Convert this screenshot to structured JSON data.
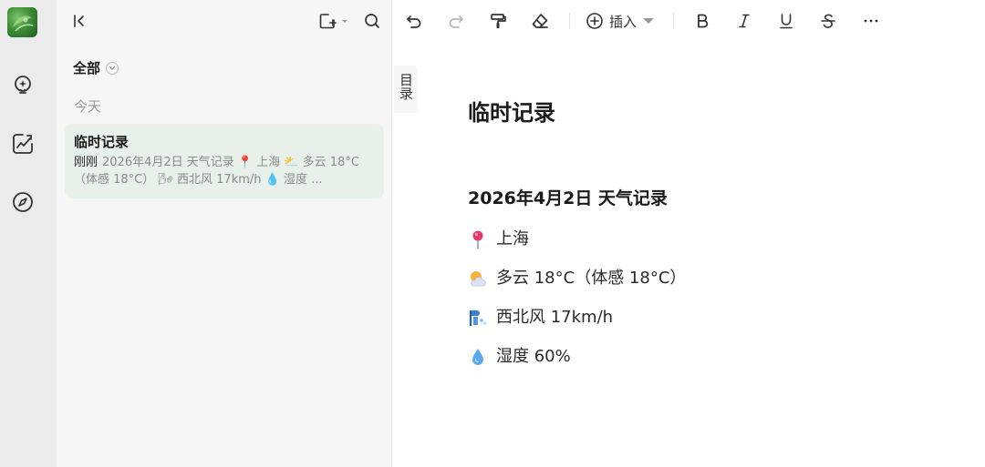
{
  "app": {
    "accent_color": "#e7f1ea"
  },
  "rail": {
    "items": [
      {
        "name": "lightbulb-icon"
      },
      {
        "name": "chart-pen-icon"
      },
      {
        "name": "compass-icon"
      }
    ]
  },
  "list_panel": {
    "folder_title": "全部",
    "group_label": "今天",
    "notes": [
      {
        "title": "临时记录",
        "time": "刚刚",
        "preview": "2026年4月2日 天气记录 📍 上海 ⛅ 多云 18°C（体感 18°C） 🌬 西北风 17km/h 💧 湿度 ..."
      }
    ]
  },
  "toolbar": {
    "insert_label": "插入"
  },
  "toc": {
    "label": "目录"
  },
  "document": {
    "title": "临时记录",
    "heading": "2026年4月2日 天气记录",
    "lines": [
      {
        "icon": "pin-icon",
        "text": "上海"
      },
      {
        "icon": "partly-cloudy-icon",
        "text": "多云 18°C（体感 18°C）"
      },
      {
        "icon": "wind-icon",
        "text": "西北风 17km/h"
      },
      {
        "icon": "droplet-icon",
        "text": "湿度 60%"
      }
    ]
  }
}
